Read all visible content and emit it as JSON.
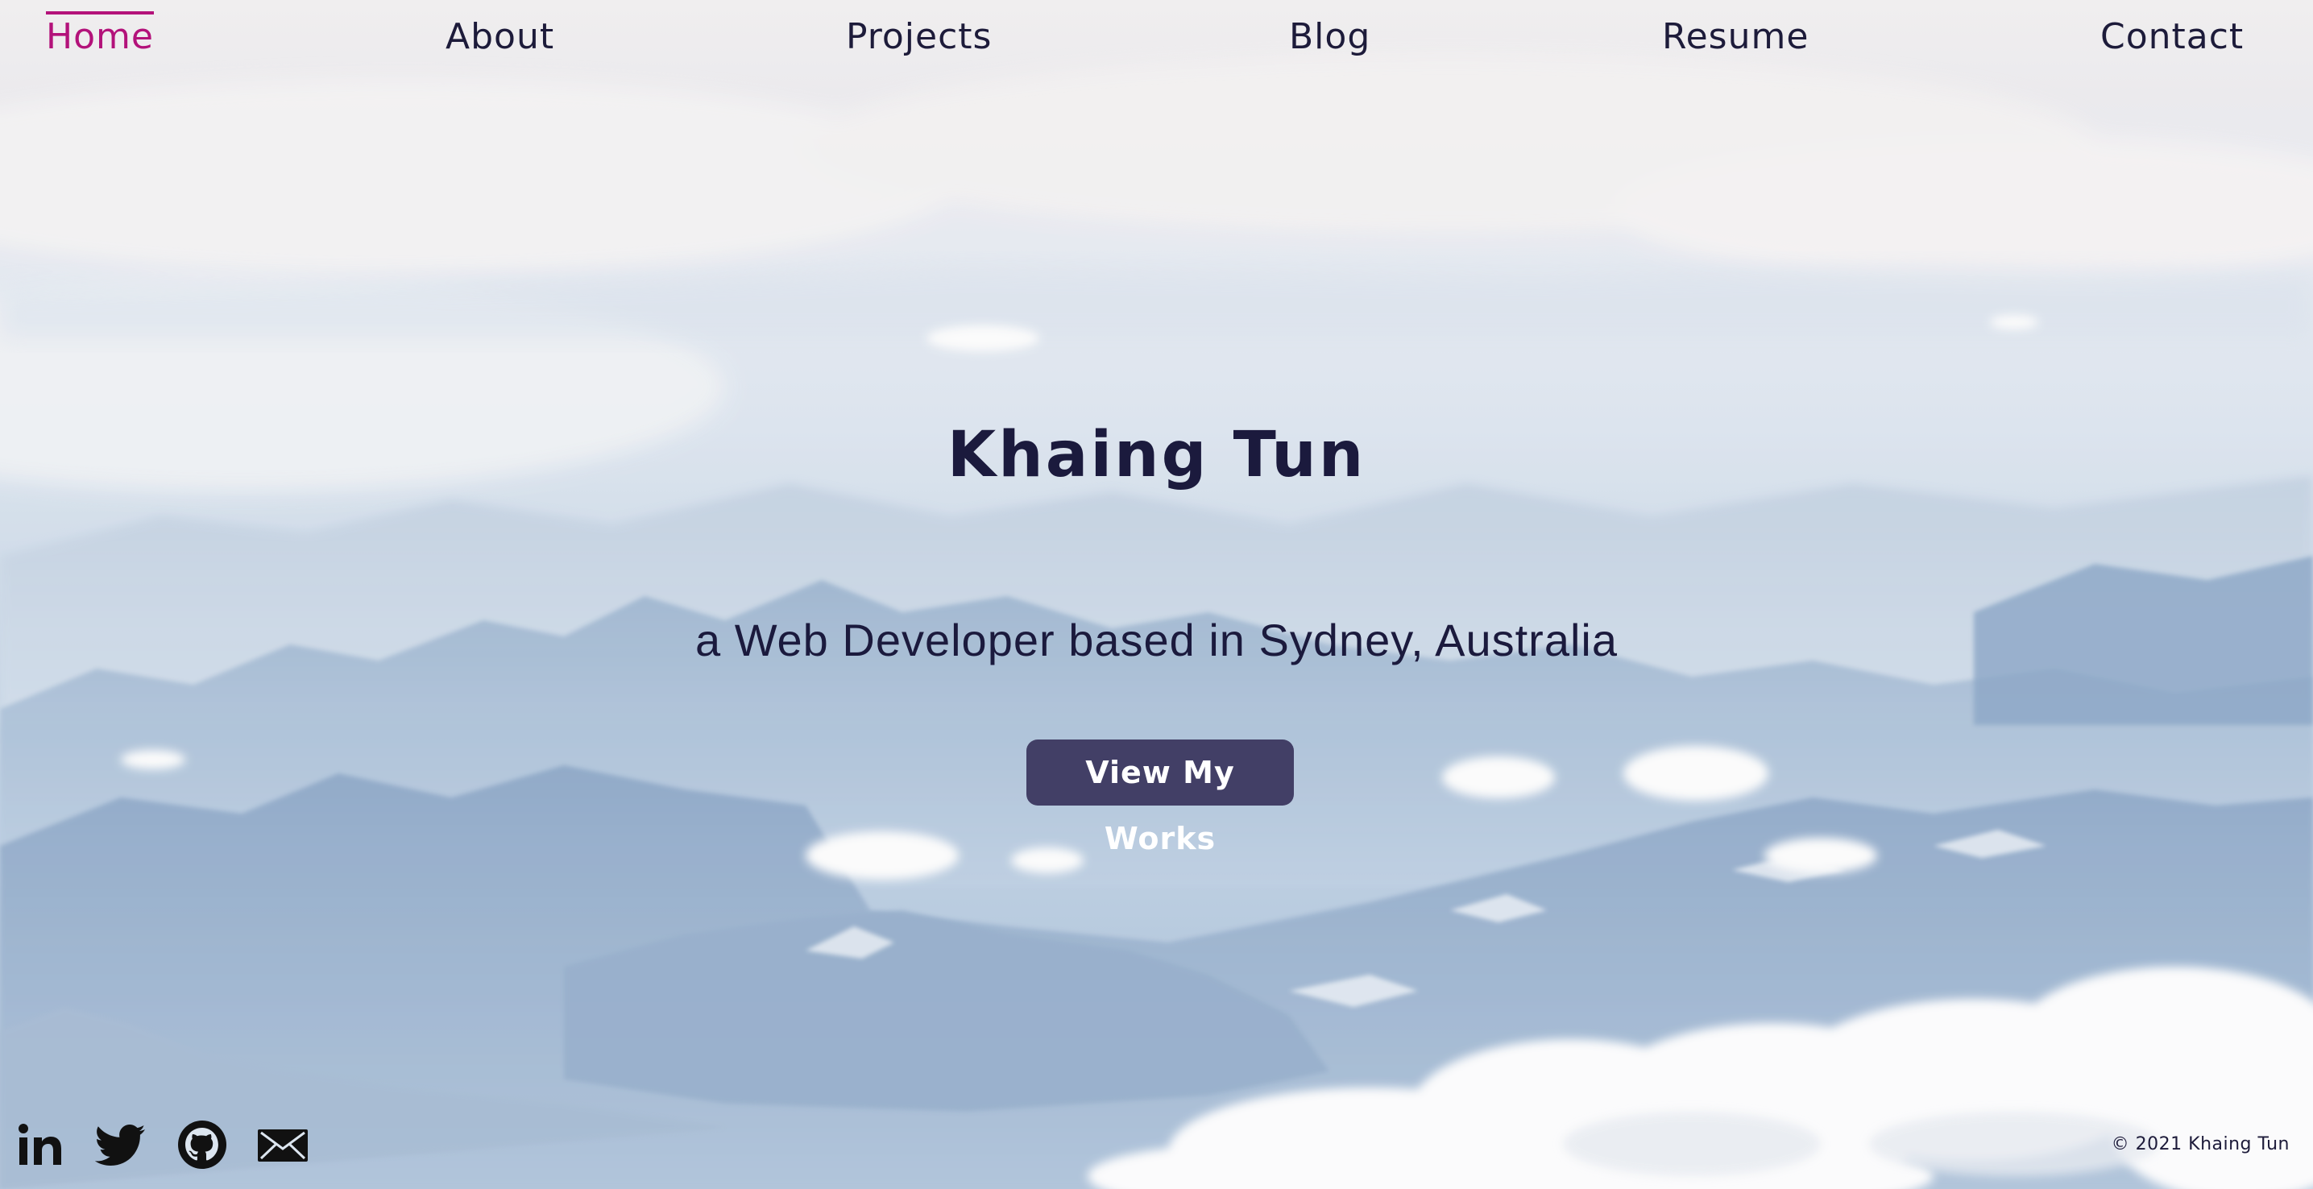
{
  "nav": {
    "items": [
      {
        "label": "Home",
        "active": true
      },
      {
        "label": "About",
        "active": false
      },
      {
        "label": "Projects",
        "active": false
      },
      {
        "label": "Blog",
        "active": false
      },
      {
        "label": "Resume",
        "active": false
      },
      {
        "label": "Contact",
        "active": false
      }
    ]
  },
  "hero": {
    "title": "Khaing Tun",
    "subtitle": "a Web Developer based in Sydney, Australia",
    "cta_label": "View My Works"
  },
  "social": [
    {
      "icon": "linkedin-icon"
    },
    {
      "icon": "twitter-icon"
    },
    {
      "icon": "github-icon"
    },
    {
      "icon": "mail-icon"
    }
  ],
  "footer": {
    "copyright": "© 2021 Khaing Tun"
  },
  "colors": {
    "accent": "#b3127a",
    "text": "#1b1a3d",
    "button": "#423f66"
  }
}
